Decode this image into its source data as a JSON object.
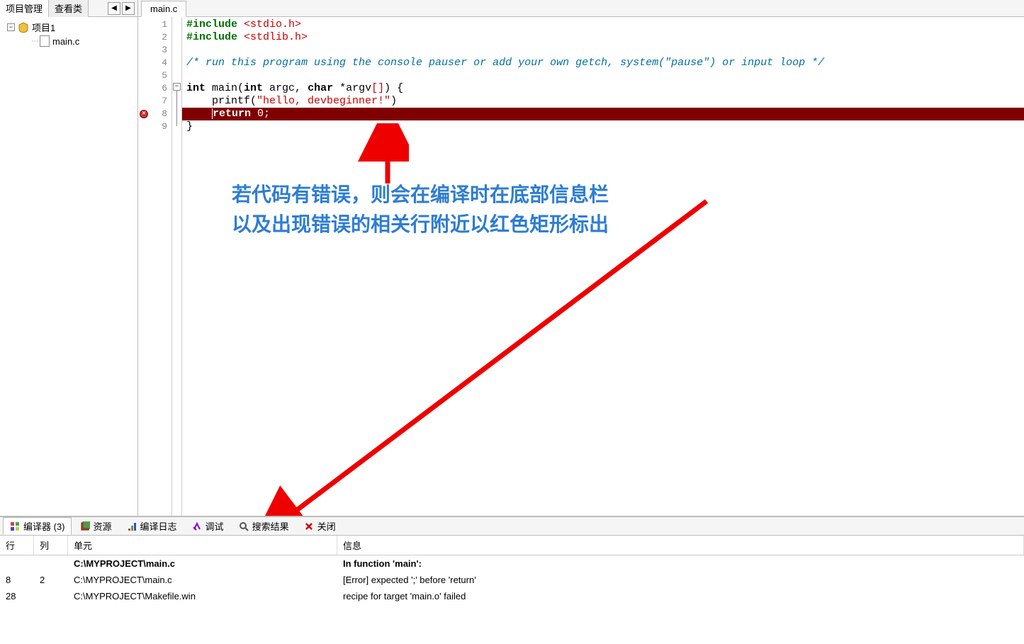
{
  "sidebar": {
    "tabs": {
      "project_mgmt": "项目管理",
      "view_class": "查看类"
    },
    "project_name": "项目1",
    "file_name": "main.c"
  },
  "editor": {
    "tab_name": "main.c",
    "lines": {
      "l1_include": "#include ",
      "l1_header": "<stdio.h>",
      "l2_include": "#include ",
      "l2_header": "<stdlib.h>",
      "l4_comment": "/* run this program using the console pauser or add your own getch, system(\"pause\") or input loop */",
      "l6_kw_int": "int",
      "l6_main": " main(",
      "l6_kw_int2": "int",
      "l6_argc": " argc, ",
      "l6_kw_char": "char",
      "l6_argv": " *argv",
      "l6_brk": "[]",
      "l6_end": ") {",
      "l7_printf": "    printf(",
      "l7_str": "\"hello, devbeginner!\"",
      "l7_end": ")",
      "l8_return": "return",
      "l8_val": " 0;",
      "l9_brace": "}"
    },
    "line_numbers": [
      "1",
      "2",
      "3",
      "4",
      "5",
      "6",
      "7",
      "8",
      "9"
    ]
  },
  "annotation": {
    "line1": "若代码有错误，则会在编译时在底部信息栏",
    "line2": "以及出现错误的相关行附近以红色矩形标出"
  },
  "bottom": {
    "tabs": {
      "compiler": "编译器 (3)",
      "resource": "资源",
      "compile_log": "编译日志",
      "debug": "调试",
      "search_result": "搜索结果",
      "close": "关闭"
    },
    "headers": {
      "line": "行",
      "col": "列",
      "unit": "单元",
      "msg": "信息"
    },
    "rows": [
      {
        "line": "",
        "col": "",
        "unit": "C:\\MYPROJECT\\main.c",
        "msg": "In function 'main':",
        "bold": true
      },
      {
        "line": "8",
        "col": "2",
        "unit": "C:\\MYPROJECT\\main.c",
        "msg": "[Error] expected ';' before 'return'",
        "bold": false
      },
      {
        "line": "28",
        "col": "",
        "unit": "C:\\MYPROJECT\\Makefile.win",
        "msg": "recipe for target 'main.o' failed",
        "bold": false
      }
    ]
  }
}
